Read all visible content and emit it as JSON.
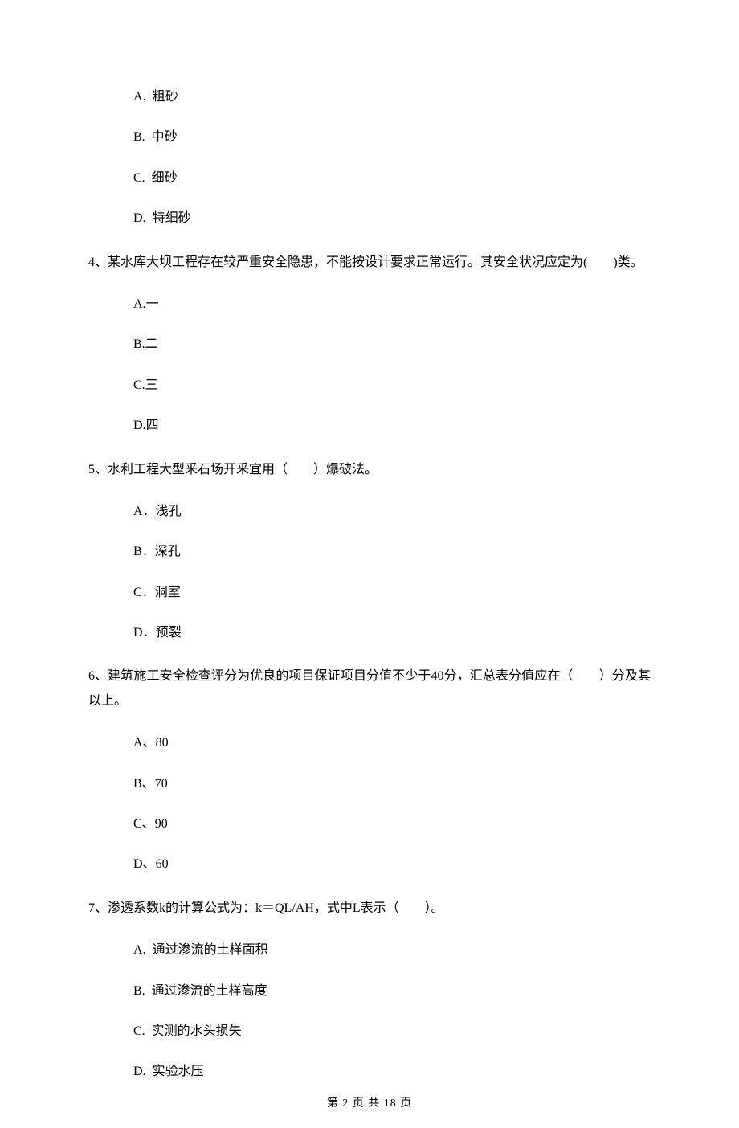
{
  "q3": {
    "options": [
      {
        "label": "A.",
        "text": "粗砂"
      },
      {
        "label": "B.",
        "text": "中砂"
      },
      {
        "label": "C.",
        "text": "细砂"
      },
      {
        "label": "D.",
        "text": "特细砂"
      }
    ]
  },
  "q4": {
    "stem": "4、某水库大坝工程存在较严重安全隐患，不能按设计要求正常运行。其安全状况应定为(　　)类。",
    "options": [
      {
        "label": "A.",
        "text": "一"
      },
      {
        "label": "B.",
        "text": "二"
      },
      {
        "label": "C.",
        "text": "三"
      },
      {
        "label": "D.",
        "text": "四"
      }
    ]
  },
  "q5": {
    "stem": "5、水利工程大型釆石场开釆宜用（　　）爆破法。",
    "options": [
      {
        "label": "A．",
        "text": "浅孔"
      },
      {
        "label": "B．",
        "text": "深孔"
      },
      {
        "label": "C．",
        "text": "洞室"
      },
      {
        "label": "D．",
        "text": "预裂"
      }
    ]
  },
  "q6": {
    "stem": "6、建筑施工安全检查评分为优良的项目保证项目分值不少于40分，汇总表分值应在（　　）分及其以上。",
    "options": [
      {
        "label": "A、",
        "text": "80"
      },
      {
        "label": "B、",
        "text": "70"
      },
      {
        "label": "C、",
        "text": "90"
      },
      {
        "label": "D、",
        "text": "60"
      }
    ]
  },
  "q7": {
    "stem": "7、渗透系数k的计算公式为：k＝QL/AH，式中L表示（　　）。",
    "options": [
      {
        "label": "A.",
        "text": "通过渗流的土样面积"
      },
      {
        "label": "B.",
        "text": "通过渗流的土样高度"
      },
      {
        "label": "C.",
        "text": "实测的水头损失"
      },
      {
        "label": "D.",
        "text": "实验水压"
      }
    ]
  },
  "footer": "第 2 页 共 18 页"
}
